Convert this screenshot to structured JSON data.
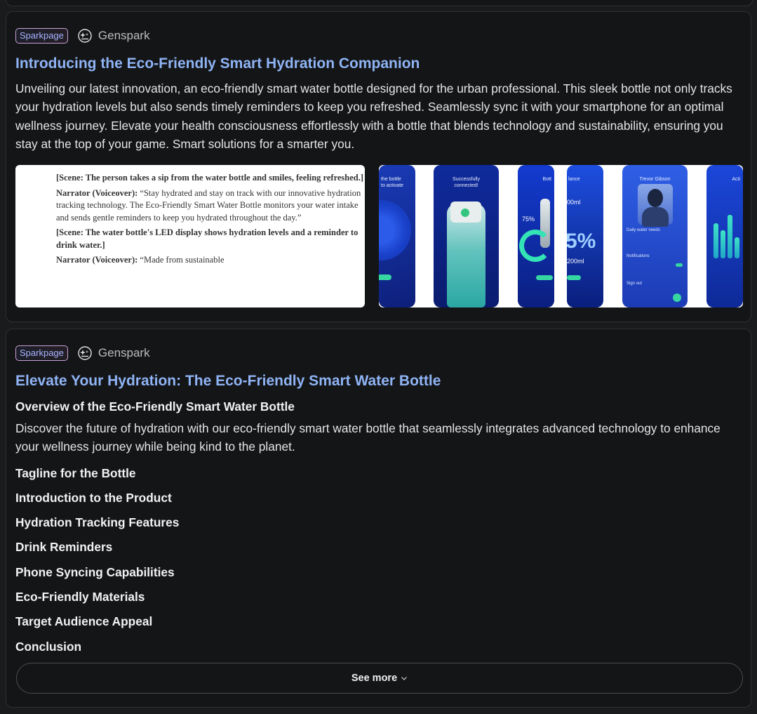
{
  "cards": [
    {
      "badge": "Sparkpage",
      "source": "Genspark",
      "title": "Introducing the Eco-Friendly Smart Hydration Companion",
      "description": "Unveiling our latest innovation, an eco-friendly smart water bottle designed for the urban professional. This sleek bottle not only tracks your hydration levels but also sends timely reminders to keep you refreshed. Seamlessly sync it with your smartphone for an optimal wellness journey. Elevate your health consciousness effortlessly with a bottle that blends technology and sustainability, ensuring you stay at the top of your game. Smart solutions for a smarter you.",
      "doc_preview": {
        "scene1": "[Scene: The person takes a sip from the water bottle and smiles, feeling refreshed.]",
        "narrator1_label": "Narrator (Voiceover):",
        "narrator1_text": " “Stay hydrated and stay on track with our innovative hydration tracking technology. The Eco-Friendly Smart Water Bottle monitors your water intake and sends gentle reminders to keep you hydrated throughout the day.”",
        "scene2": "[Scene: The water bottle's LED display shows hydration levels and a reminder to drink water.]",
        "narrator2_label": "Narrator (Voiceover):",
        "narrator2_text": " “Made from sustainable"
      },
      "app_preview": {
        "screen_a": "the bottle\nto activate",
        "screen_b": "Successfully\nconnected!",
        "screen_c": "Bott",
        "screen_c_pct": "75%",
        "screen_d": "lance",
        "screen_d_ml": "00ml",
        "screen_d_pct": "5%",
        "screen_d_ml2": "200ml",
        "screen_e": "Trevor Gibson",
        "screen_e_row1": "Daily water needs",
        "screen_e_row2": "Notifications",
        "screen_e_row3": "Sign out",
        "screen_f": "Acti"
      }
    },
    {
      "badge": "Sparkpage",
      "source": "Genspark",
      "title": "Elevate Your Hydration: The Eco-Friendly Smart Water Bottle",
      "overview_heading": "Overview of the Eco-Friendly Smart Water Bottle",
      "overview_text": "Discover the future of hydration with our eco-friendly smart water bottle that seamlessly integrates advanced technology to enhance your wellness journey while being kind to the planet.",
      "toc": [
        "Tagline for the Bottle",
        "Introduction to the Product",
        "Hydration Tracking Features",
        "Drink Reminders",
        "Phone Syncing Capabilities",
        "Eco-Friendly Materials",
        "Target Audience Appeal",
        "Conclusion"
      ],
      "see_more": "See more"
    }
  ],
  "icons": {
    "source": "genspark-logo-icon",
    "expand": "chevron-down-icon"
  },
  "colors": {
    "title": "#8fb4f5",
    "badge_text": "#a7b4ff",
    "background": "#141517"
  }
}
